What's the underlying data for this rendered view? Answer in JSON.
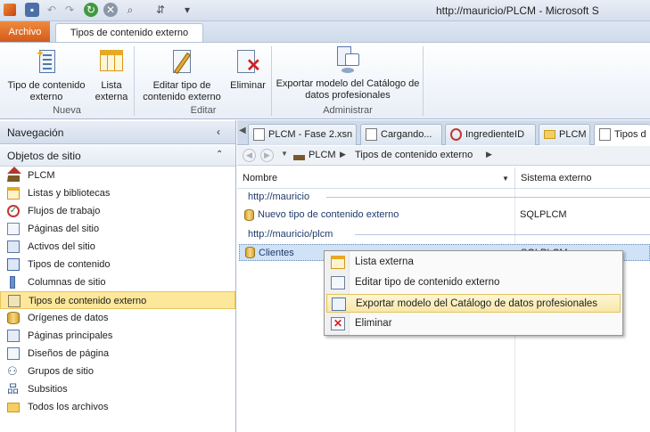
{
  "window": {
    "title": "http://mauricio/PLCM  -  Microsoft S"
  },
  "ribbon_tabs": {
    "file": "Archivo",
    "active": "Tipos de contenido externo"
  },
  "ribbon": {
    "buttons": {
      "tipo_contenido": "Tipo de contenido externo",
      "lista_externa": "Lista externa",
      "editar_tipo": "Editar tipo de contenido externo",
      "eliminar": "Eliminar",
      "exportar": "Exportar modelo del Catálogo de datos profesionales"
    },
    "groups": {
      "nueva": "Nueva",
      "editar": "Editar",
      "administrar": "Administrar"
    }
  },
  "nav": {
    "header": "Navegación",
    "section": "Objetos de sitio",
    "items": [
      "PLCM",
      "Listas y bibliotecas",
      "Flujos de trabajo",
      "Páginas del sitio",
      "Activos del sitio",
      "Tipos de contenido",
      "Columnas de sitio",
      "Tipos de contenido externo",
      "Orígenes de datos",
      "Páginas principales",
      "Diseños de página",
      "Grupos de sitio",
      "Subsitios",
      "Todos los archivos"
    ],
    "selected": 7
  },
  "doc_tabs": [
    "PLCM - Fase 2.xsn",
    "Cargando...",
    "IngredienteID",
    "PLCM",
    "Tipos d"
  ],
  "breadcrumb": {
    "site": "PLCM",
    "current": "Tipos de contenido externo"
  },
  "grid": {
    "columns": {
      "name": "Nombre",
      "system": "Sistema externo"
    },
    "groups": [
      {
        "label": "http://mauricio",
        "rows": [
          {
            "name": "Nuevo tipo de contenido externo",
            "system": "SQLPLCM"
          }
        ]
      },
      {
        "label": "http://mauricio/plcm",
        "rows": [
          {
            "name": "Clientes",
            "system": "SQLPLCM"
          }
        ]
      }
    ]
  },
  "context_menu": {
    "items": [
      "Lista externa",
      "Editar tipo de contenido externo",
      "Exportar modelo del Catálogo de datos profesionales",
      "Eliminar"
    ],
    "highlighted": 2
  },
  "colors": {
    "accent_orange": "#e06f2c",
    "selection": "#fde79a",
    "link": "#1f3a6b"
  }
}
